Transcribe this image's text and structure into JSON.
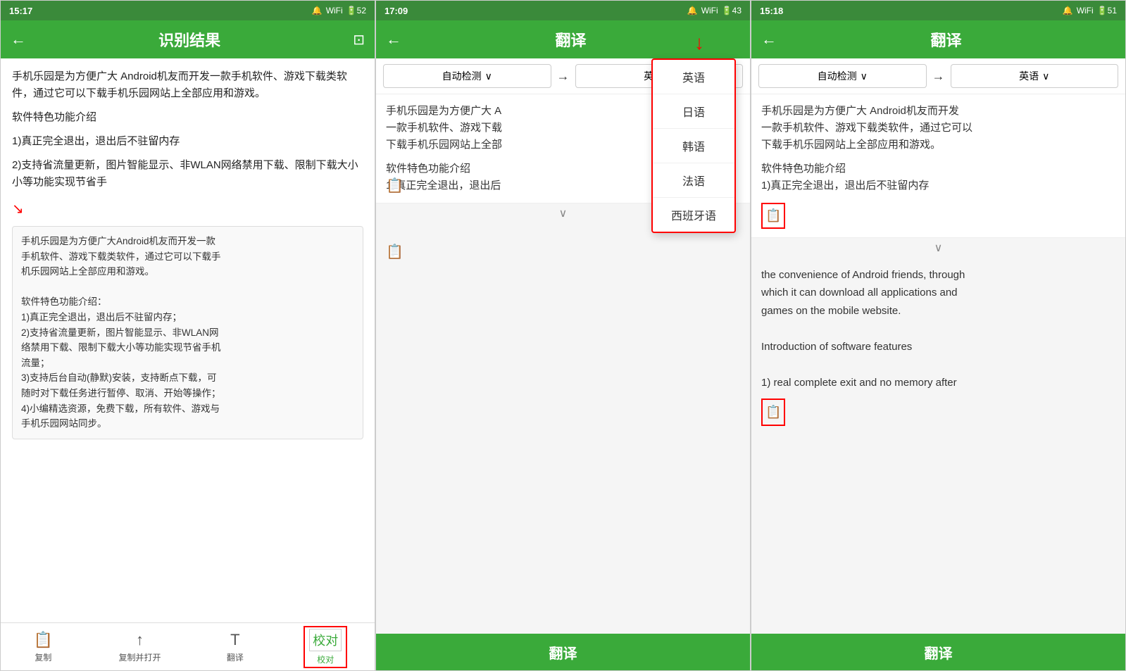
{
  "screen1": {
    "status": {
      "time": "15:17",
      "battery": "52",
      "signal": "WiFi"
    },
    "title": "识别结果",
    "content": {
      "paragraph1": "手机乐园是为方便广大  Android机友而开发一款手机软件、游戏下载类软件，通过它可以下载手机乐园网站上全部应用和游戏。",
      "paragraph2": "软件特色功能介绍",
      "paragraph3": "1)真正完全退出，退出后不驻留内存",
      "paragraph4": "2)支持省流量更新，图片智能显示、非WLAN网络禁用下载、限制下载大小小等功能实现节省手",
      "ocr_block": {
        "line1": "手机乐园是为方便广大Android机友而开发一款",
        "line2": "手机软件、游戏下载类软件，通过它可以下载手",
        "line3": "机乐园网站上全部应用和游戏。",
        "line4": "",
        "line5": "软件特色功能介绍：",
        "line6": "1)真正完全退出，退出后不驻留内存；",
        "line7": "2)支持省流量更新，图片智能显示、非WLAN网",
        "line8": "络禁用下载、限制下载大小等功能实现节省手机",
        "line9": "流量；",
        "line10": "3)支持后台自动(静默)安装，支持断点下载，可",
        "line11": "随时对下载任务进行暂停、取消、开始等操作；",
        "line12": "4)小编精选资源，免费下载，所有软件、游戏与",
        "line13": "手机乐园网站同步。"
      }
    },
    "nav": {
      "copy": "复制",
      "copy_open": "复制并打开",
      "translate": "翻译",
      "proofread": "校对"
    }
  },
  "screen2": {
    "status": {
      "time": "17:09",
      "battery": "43"
    },
    "title": "翻译",
    "lang_from": "自动检测",
    "lang_to": "英语",
    "arrow": "→",
    "source_text_line1": "手机乐园是为方便广大  A",
    "source_text_line2": "一款手机软件、游戏下载",
    "source_text_line3": "下载手机乐园网站上全部",
    "source_text_para2": "软件特色功能介绍",
    "source_text_para3": "1)真正完全退出，退出后",
    "dropdown": {
      "items": [
        "英语",
        "日语",
        "韩语",
        "法语",
        "西班牙语"
      ]
    },
    "translate_btn": "翻译"
  },
  "screen3": {
    "status": {
      "time": "15:18",
      "battery": "51"
    },
    "title": "翻译",
    "lang_from": "自动检测",
    "lang_to": "英语",
    "arrow": "→",
    "source_text_line1": "手机乐园是为方便广大  Android机友而开发",
    "source_text_line2": "一款手机软件、游戏下载类软件，通过它可以",
    "source_text_line3": "下载手机乐园网站上全部应用和游戏。",
    "source_text_para2": "软件特色功能介绍",
    "source_text_para3": "1)真正完全退出，退出后不驻留内存",
    "output": {
      "line1": "the convenience of Android friends, through",
      "line2": "which it can download all applications and",
      "line3": "games on the mobile website.",
      "line4": "",
      "line5": "Introduction of software features",
      "line6": "",
      "line7": "1) real complete exit and no memory after"
    },
    "translate_btn": "翻译"
  },
  "icons": {
    "back": "←",
    "scan": "⊡",
    "copy": "📋",
    "share": "↑",
    "translate_nav": "T",
    "proofread": "校",
    "chevron_down": "∨",
    "wifi": "▲",
    "battery": "▮"
  }
}
